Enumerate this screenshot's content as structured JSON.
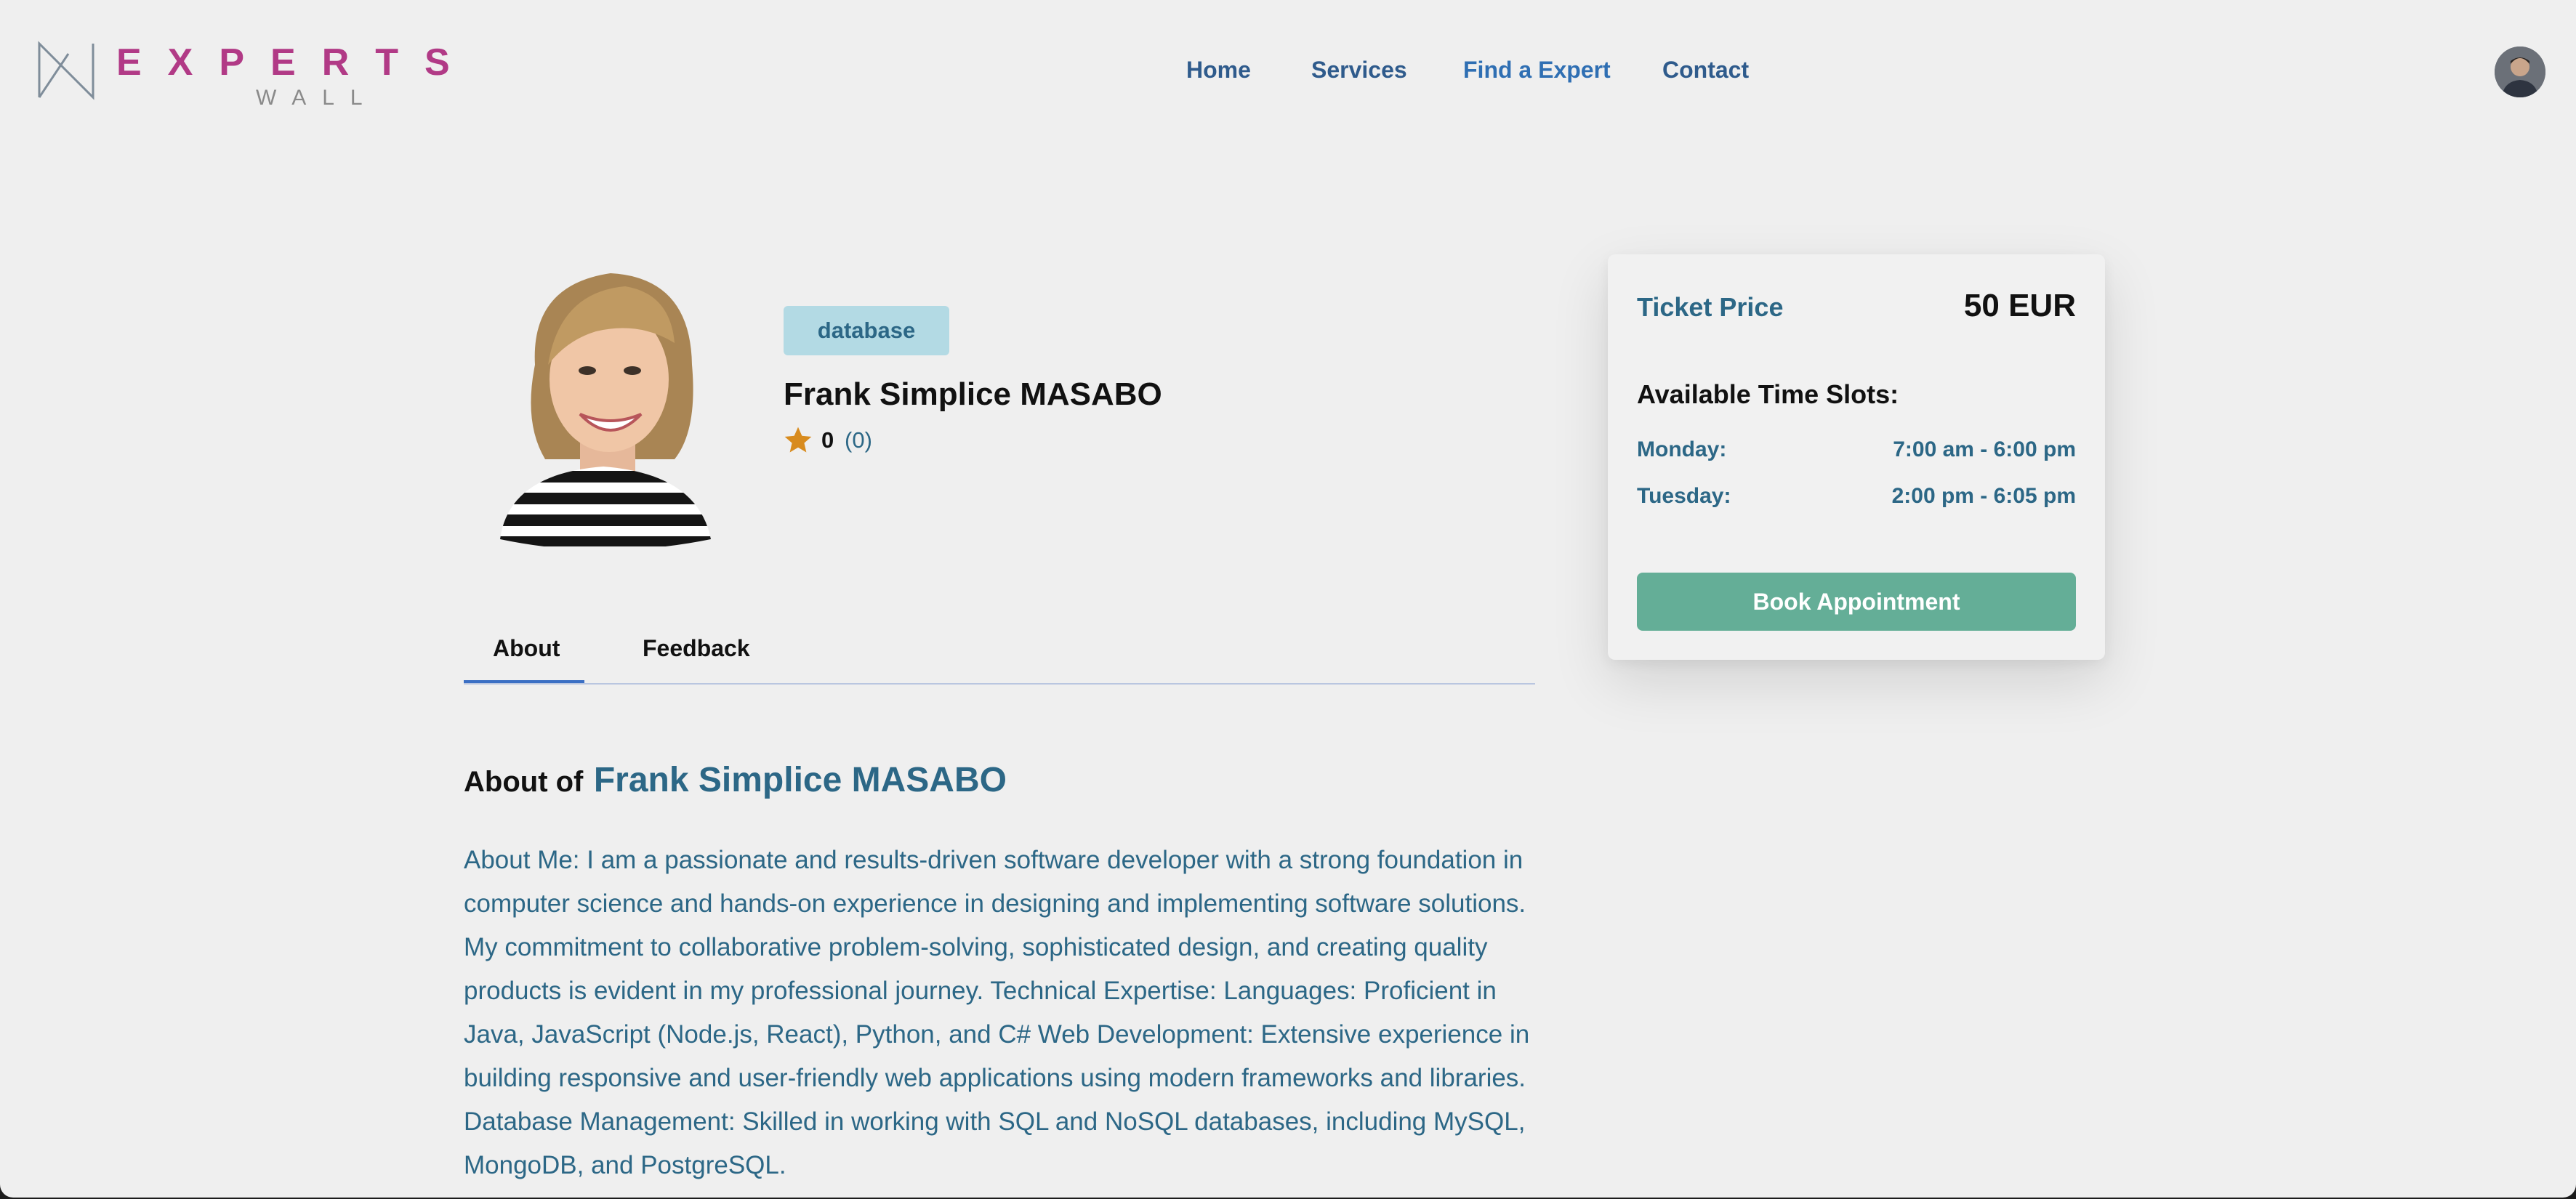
{
  "header": {
    "logo": {
      "top_text": "EXPERTS",
      "bottom_text": "WALL",
      "brand_color": "#b13a86"
    },
    "nav": [
      {
        "label": "Home"
      },
      {
        "label": "Services"
      },
      {
        "label": "Find a Expert",
        "active": true
      },
      {
        "label": "Contact"
      }
    ],
    "user_avatar": "user-avatar-icon"
  },
  "profile": {
    "photo": "expert-portrait",
    "specialty_tag": "database",
    "name": "Frank Simplice MASABO",
    "rating": {
      "average": "0",
      "count": "(0)"
    }
  },
  "tabs": [
    {
      "label": "About",
      "active": true
    },
    {
      "label": "Feedback",
      "active": false
    }
  ],
  "about": {
    "heading_label": "About of",
    "heading_name": "Frank Simplice MASABO",
    "text": "About Me: I am a passionate and results-driven software developer with a strong foundation in computer science and hands-on experience in designing and implementing software solutions. My commitment to collaborative problem-solving, sophisticated design, and creating quality products is evident in my professional journey. Technical Expertise: Languages: Proficient in Java, JavaScript (Node.js, React), Python, and C# Web Development: Extensive experience in building responsive and user-friendly web applications using modern frameworks and libraries. Database Management: Skilled in working with SQL and NoSQL databases, including MySQL, MongoDB, and PostgreSQL."
  },
  "booking": {
    "price_label": "Ticket Price",
    "price_value": "50 EUR",
    "slots_title": "Available Time Slots:",
    "slots": [
      {
        "day": "Monday:",
        "time": "7:00 am - 6:00 pm"
      },
      {
        "day": "Tuesday:",
        "time": "2:00 pm - 6:05 pm"
      }
    ],
    "book_button": "Book Appointment"
  },
  "colors": {
    "accent": "#2c6786",
    "button": "#64ae97",
    "tag_bg": "#b3dae4",
    "tab_underline": "#3b6fc4"
  }
}
